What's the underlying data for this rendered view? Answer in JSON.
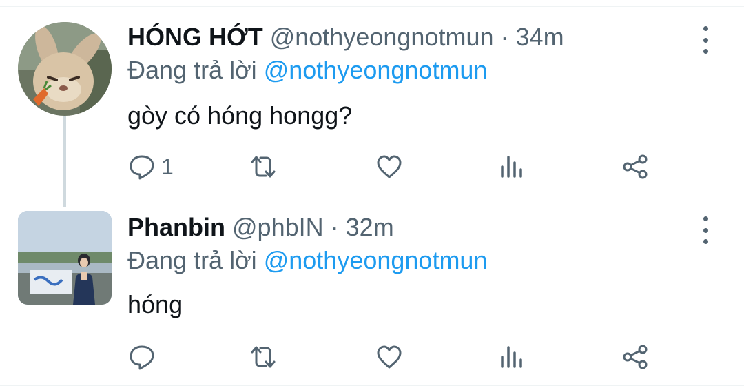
{
  "tweets": [
    {
      "name": "HÓNG HỚT",
      "handle": "@nothyeongnotmun",
      "separator": "·",
      "time": "34m",
      "reply_prefix": "Đang trả lời",
      "reply_to": "@nothyeongnotmun",
      "text": "gòy có hóng hongg?",
      "reply_count": "1"
    },
    {
      "name": "Phanbin",
      "handle": "@phbIN",
      "separator": "·",
      "time": "32m",
      "reply_prefix": "Đang trả lời",
      "reply_to": "@nothyeongnotmun",
      "text": "hóng",
      "reply_count": ""
    }
  ],
  "icons": {
    "reply": "speech-bubble-icon",
    "retweet": "retweet-arrows-icon",
    "like": "heart-icon",
    "views": "bar-chart-icon",
    "share": "share-nodes-icon",
    "more": "vertical-dots-icon"
  },
  "colors": {
    "text": "#0f1419",
    "muted": "#536471",
    "link": "#1d9bf0",
    "thread_line": "#cfd9de"
  }
}
